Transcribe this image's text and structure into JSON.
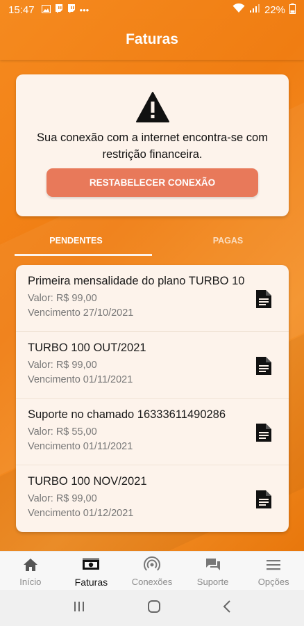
{
  "status_bar": {
    "time": "15:47",
    "battery": "22%"
  },
  "header": {
    "title": "Faturas"
  },
  "alert": {
    "message": "Sua conexão com a internet encontra-se com restrição financeira.",
    "button_label": "RESTABELECER CONEXÃO"
  },
  "tabs": [
    {
      "label": "PENDENTES",
      "active": true
    },
    {
      "label": "PAGAS",
      "active": false
    }
  ],
  "invoices": [
    {
      "title": "Primeira mensalidade do plano TURBO 100",
      "value": "Valor: R$ 99,00",
      "due": "Vencimento 27/10/2021"
    },
    {
      "title": "TURBO 100 OUT/2021",
      "value": "Valor: R$ 99,00",
      "due": "Vencimento 01/11/2021"
    },
    {
      "title": "Suporte no chamado 16333611490286",
      "value": "Valor: R$ 55,00",
      "due": "Vencimento 01/11/2021"
    },
    {
      "title": "TURBO 100 NOV/2021",
      "value": "Valor: R$ 99,00",
      "due": "Vencimento 01/12/2021"
    }
  ],
  "bottom_nav": [
    {
      "label": "Início",
      "icon": "home-icon",
      "active": false
    },
    {
      "label": "Faturas",
      "icon": "money-icon",
      "active": true
    },
    {
      "label": "Conexões",
      "icon": "wifi-signal-icon",
      "active": false
    },
    {
      "label": "Suporte",
      "icon": "chat-icon",
      "active": false
    },
    {
      "label": "Opções",
      "icon": "menu-icon",
      "active": false
    }
  ],
  "colors": {
    "brand_orange": "#f58a1f",
    "card_bg": "#fdf3eb",
    "button_bg": "#e8795a"
  }
}
